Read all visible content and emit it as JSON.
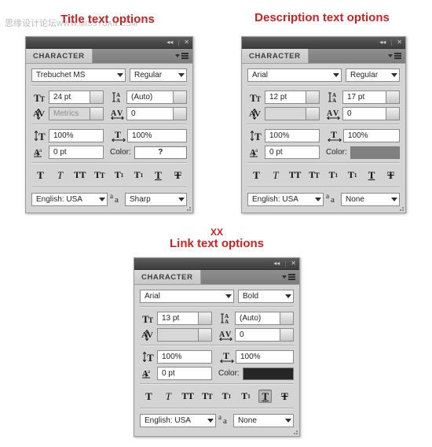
{
  "watermark": {
    "site_cn": "思缘设计论坛",
    "site_url": "WWW.MISSYUAN.COM"
  },
  "captions": {
    "title_panel": "Title text options",
    "description_panel": "Description text options",
    "link_panel_prefix": "XX",
    "link_panel": "Link text options"
  },
  "panel_chrome": {
    "tab_label": "CHARACTER",
    "collapse_icon": "◀◀",
    "separator": "|",
    "close_icon": "✕",
    "menu_icon": "panel-menu-icon"
  },
  "labels": {
    "color": "Color:",
    "font_size_icon": "font-size-icon",
    "leading_icon": "leading-icon",
    "kerning_icon": "kerning-icon",
    "tracking_icon": "tracking-icon",
    "vertical_scale_icon": "vertical-scale-icon",
    "horizontal_scale_icon": "horizontal-scale-icon",
    "baseline_shift_icon": "baseline-shift-icon",
    "anti_alias_icon": "anti-alias-icon"
  },
  "style_buttons": [
    {
      "name": "faux-bold",
      "glyph": "T",
      "class": "sb-t"
    },
    {
      "name": "faux-italic",
      "glyph": "T",
      "class": "sb-i"
    },
    {
      "name": "all-caps",
      "glyph": "TT",
      "class": "sb-tt"
    },
    {
      "name": "small-caps",
      "glyph": "Tт",
      "class": "sb-sc"
    },
    {
      "name": "superscript",
      "glyph": "T¹",
      "class": "sb-sup"
    },
    {
      "name": "subscript",
      "glyph": "T₁",
      "class": "sb-sub"
    },
    {
      "name": "underline",
      "glyph": "T",
      "class": "sb-u"
    },
    {
      "name": "strikethrough",
      "glyph": "Ŧ",
      "class": "sb-s"
    }
  ],
  "panels": [
    {
      "id": "title",
      "font_family": "Trebuchet MS",
      "font_style": "Regular",
      "font_size": "24 pt",
      "leading": "(Auto)",
      "kerning": "Metrics",
      "kerning_dim": true,
      "tracking": "0",
      "vertical_scale": "100%",
      "horizontal_scale": "100%",
      "baseline_shift": "0 pt",
      "color_value": "#ffffff",
      "color_text": "?",
      "language": "English: USA",
      "anti_alias": "Sharp",
      "active_style": null
    },
    {
      "id": "description",
      "font_family": "Arial",
      "font_style": "Regular",
      "font_size": "12 pt",
      "leading": "17 pt",
      "kerning": "",
      "kerning_dim": true,
      "tracking": "0",
      "vertical_scale": "100%",
      "horizontal_scale": "100%",
      "baseline_shift": "0 pt",
      "color_value": "#808080",
      "color_text": "",
      "language": "English: USA",
      "anti_alias": "None",
      "active_style": null
    },
    {
      "id": "link",
      "font_family": "Arial",
      "font_style": "Bold",
      "font_size": "13 pt",
      "leading": "(Auto)",
      "kerning": "",
      "kerning_dim": true,
      "tracking": "0",
      "vertical_scale": "100%",
      "horizontal_scale": "100%",
      "baseline_shift": "0 pt",
      "color_value": "#262626",
      "color_text": "",
      "language": "English: USA",
      "anti_alias": "None",
      "active_style": "underline"
    }
  ]
}
